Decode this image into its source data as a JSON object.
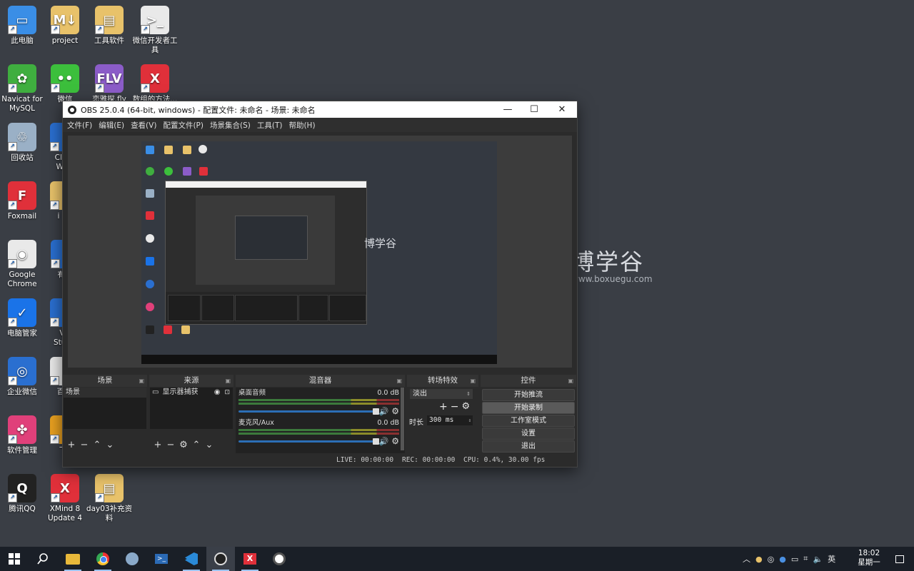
{
  "desktop": {
    "icons": [
      {
        "label": "此电脑",
        "color": "#3a8ee6",
        "glyph": "▭"
      },
      {
        "label": "project",
        "color": "#e8c26a",
        "glyph": "M↓"
      },
      {
        "label": "工具软件",
        "color": "#e8c26a",
        "glyph": "▤"
      },
      {
        "label": "微信开发者工具",
        "color": "#e9e9e9",
        "glyph": ">_"
      },
      {
        "label": "Navicat for MySQL",
        "color": "#3fae3f",
        "glyph": "✿"
      },
      {
        "label": "微信",
        "color": "#3cbf3c",
        "glyph": "••"
      },
      {
        "label": "恋雅探.flv",
        "color": "#8b5cc8",
        "glyph": "FLV"
      },
      {
        "label": "数组的方法...",
        "color": "#e0303a",
        "glyph": "X"
      },
      {
        "label": "回收站",
        "color": "#9ab0c6",
        "glyph": "♲"
      },
      {
        "label": "Cla Wi",
        "color": "#2a6fd0",
        "glyph": ""
      },
      {
        "label": "Foxmail",
        "color": "#e0303a",
        "glyph": "F"
      },
      {
        "label": "i",
        "color": "#e8c26a",
        "glyph": ""
      },
      {
        "label": "Google Chrome",
        "color": "#e9e9e9",
        "glyph": "◉"
      },
      {
        "label": "有道",
        "color": "#2a6fd0",
        "glyph": ""
      },
      {
        "label": "电脑管家",
        "color": "#1a73e8",
        "glyph": "✓"
      },
      {
        "label": "V Stud",
        "color": "#2a6fd0",
        "glyph": ""
      },
      {
        "label": "企业微信",
        "color": "#2a6fd0",
        "glyph": "◎"
      },
      {
        "label": "百",
        "color": "#e9e9e9",
        "glyph": ""
      },
      {
        "label": "软件管理",
        "color": "#e0407a",
        "glyph": "✤"
      },
      {
        "label": "飞",
        "color": "#e8a020",
        "glyph": ""
      },
      {
        "label": "腾讯QQ",
        "color": "#222",
        "glyph": "Q"
      },
      {
        "label": "XMind 8 Update 4",
        "color": "#e0303a",
        "glyph": "X"
      },
      {
        "label": "day03补充资料",
        "color": "#e8c26a",
        "glyph": "▤"
      }
    ],
    "watermark": {
      "title": "博学谷",
      "url": "www.boxuegu.com"
    }
  },
  "obs": {
    "title": "OBS 25.0.4 (64-bit, windows) - 配置文件: 未命名 - 场景: 未命名",
    "window_buttons": {
      "minimize": "—",
      "maximize": "☐",
      "close": "✕"
    },
    "menu": [
      "文件(F)",
      "编辑(E)",
      "查看(V)",
      "配置文件(P)",
      "场景集合(S)",
      "工具(T)",
      "帮助(H)"
    ],
    "preview_watermark": "博学谷",
    "scenes": {
      "title": "场景",
      "items": [
        "场景"
      ]
    },
    "sources": {
      "title": "来源",
      "items": [
        "显示器捕获"
      ]
    },
    "mixer": {
      "title": "混音器",
      "channels": [
        {
          "name": "桌面音频",
          "level": "0.0 dB",
          "volume": 1.0
        },
        {
          "name": "麦克风/Aux",
          "level": "0.0 dB",
          "volume": 1.0
        }
      ]
    },
    "transitions": {
      "title": "转场特效",
      "selected": "淡出",
      "duration_label": "时长",
      "duration_value": "300 ms"
    },
    "controls": {
      "title": "控件",
      "buttons": [
        "开始推流",
        "开始录制",
        "工作室模式",
        "设置",
        "退出"
      ]
    },
    "status": {
      "live": "LIVE: 00:00:00",
      "rec": "REC: 00:00:00",
      "cpu": "CPU: 0.4%, 30.00 fps"
    }
  },
  "taskbar": {
    "items": [
      "start",
      "search",
      "file-explorer",
      "chrome",
      "app-bird",
      "powershell",
      "vscode",
      "obs",
      "xmind",
      "chrome-alt"
    ],
    "ime": "英",
    "time": "18:02",
    "date": "星期一"
  }
}
